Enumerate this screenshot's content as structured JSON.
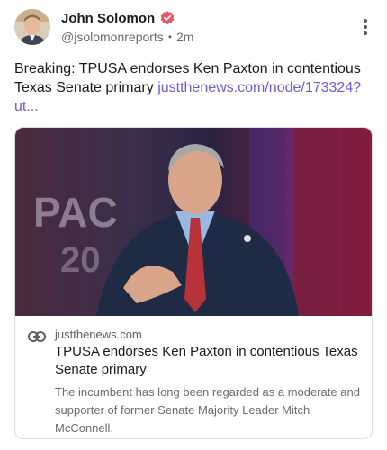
{
  "author": {
    "display_name": "John Solomon",
    "handle": "@jsolomonreports",
    "time_ago": "2m",
    "verified": true
  },
  "post": {
    "text": "Breaking: TPUSA endorses Ken Paxton in contentious Texas Senate primary",
    "link_text": "justthenews.com/node/173324?ut..."
  },
  "link_card": {
    "domain": "justthenews.com",
    "title": "TPUSA endorses Ken Paxton in contentious Texas Senate primary",
    "description": "The incumbent has long been regarded as a moderate and supporter of former Senate Majority Leader Mitch McConnell."
  },
  "colors": {
    "link": "#6b5bd6",
    "verified_badge": "#e8566c",
    "text": "#1a1a1a",
    "muted": "#6b6b6b"
  },
  "icons": {
    "verified": "verified-badge-icon",
    "more": "more-vertical-icon",
    "link": "link-chain-icon"
  }
}
